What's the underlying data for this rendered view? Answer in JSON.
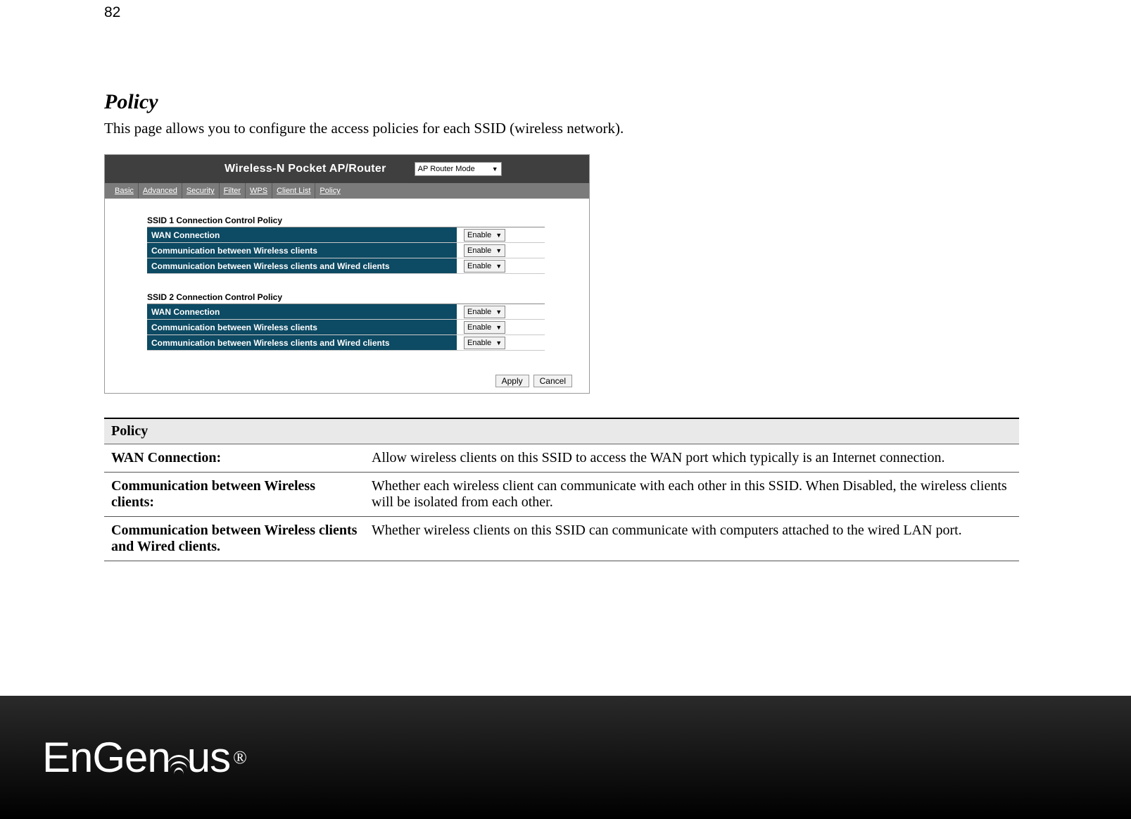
{
  "page_number": "82",
  "section": {
    "title": "Policy",
    "description": "This page allows you to configure the access policies for each SSID (wireless network)."
  },
  "router": {
    "title": "Wireless-N Pocket AP/Router",
    "mode": "AP Router Mode",
    "tabs": [
      "Basic",
      "Advanced",
      "Security",
      "Filter",
      "WPS",
      "Client List",
      "Policy"
    ],
    "blocks": [
      {
        "caption": "SSID 1 Connection Control Policy",
        "rows": [
          {
            "label": "WAN Connection",
            "value": "Enable"
          },
          {
            "label": "Communication between Wireless clients",
            "value": "Enable"
          },
          {
            "label": "Communication between Wireless clients and Wired clients",
            "value": "Enable"
          }
        ]
      },
      {
        "caption": "SSID 2 Connection Control Policy",
        "rows": [
          {
            "label": "WAN Connection",
            "value": "Enable"
          },
          {
            "label": "Communication between Wireless clients",
            "value": "Enable"
          },
          {
            "label": "Communication between Wireless clients and Wired clients",
            "value": "Enable"
          }
        ]
      }
    ],
    "actions": {
      "apply": "Apply",
      "cancel": "Cancel"
    }
  },
  "desc_table": {
    "header": "Policy",
    "rows": [
      {
        "term": "WAN Connection:",
        "desc": "Allow wireless clients on this SSID to access the WAN port which typically is an Internet connection."
      },
      {
        "term": "Communication between Wireless clients:",
        "desc": "Whether each wireless client can communicate with each other in this SSID. When Disabled, the wireless clients will be isolated from each other."
      },
      {
        "term": "Communication between Wireless clients and Wired clients.",
        "desc": "Whether wireless clients on this SSID can communicate with computers attached to the wired LAN port."
      }
    ]
  },
  "footer": {
    "brand_part1": "EnGen",
    "brand_part2": "us",
    "registered": "®"
  }
}
